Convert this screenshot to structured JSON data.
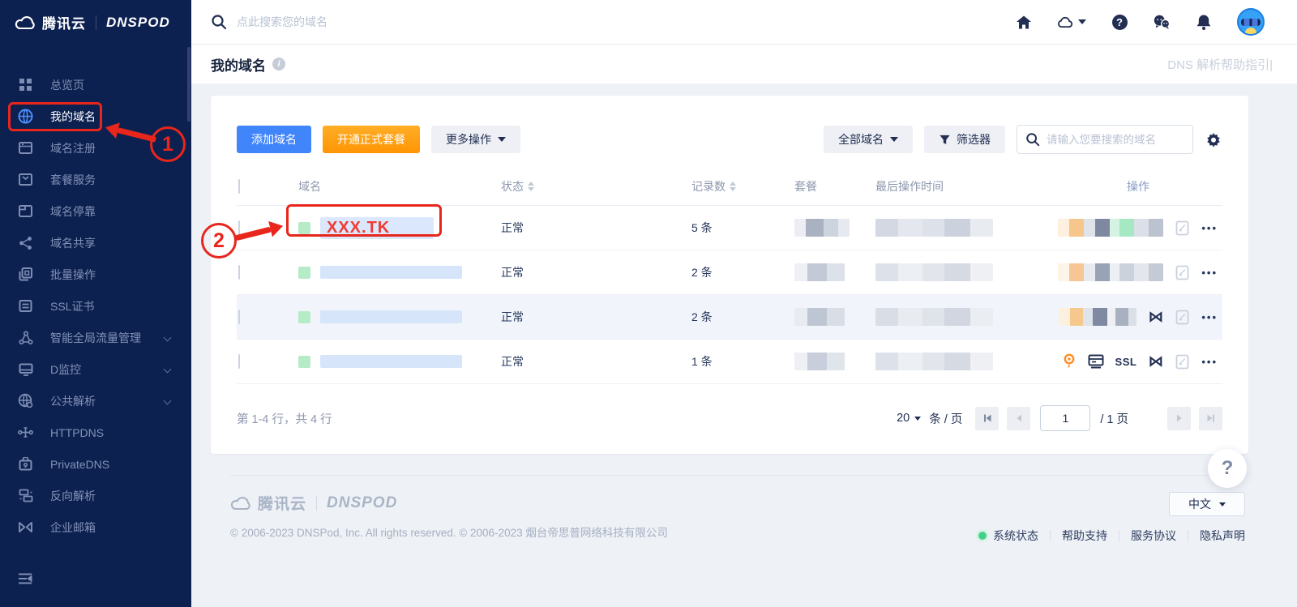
{
  "brand": {
    "name": "腾讯云",
    "product": "DNSPOD"
  },
  "topbar": {
    "search_placeholder": "点此搜索您的域名",
    "help_glyph": "?"
  },
  "sidebar": {
    "items": [
      {
        "label": "总览页",
        "icon": "grid-icon"
      },
      {
        "label": "我的域名",
        "icon": "globe-icon",
        "active": true
      },
      {
        "label": "域名注册",
        "icon": "browser-icon"
      },
      {
        "label": "套餐服务",
        "icon": "package-icon"
      },
      {
        "label": "域名停靠",
        "icon": "parking-icon"
      },
      {
        "label": "域名共享",
        "icon": "share-icon"
      },
      {
        "label": "批量操作",
        "icon": "batch-icon"
      },
      {
        "label": "SSL证书",
        "icon": "certificate-icon"
      },
      {
        "label": "智能全局流量管理",
        "icon": "traffic-icon",
        "expandable": true
      },
      {
        "label": "D监控",
        "icon": "monitor-icon",
        "expandable": true
      },
      {
        "label": "公共解析",
        "icon": "public-dns-icon",
        "expandable": true
      },
      {
        "label": "HTTPDNS",
        "icon": "httpdns-icon"
      },
      {
        "label": "PrivateDNS",
        "icon": "privatedns-icon"
      },
      {
        "label": "反向解析",
        "icon": "reverse-dns-icon"
      },
      {
        "label": "企业邮箱",
        "icon": "mail-icon"
      }
    ]
  },
  "page": {
    "title": "我的域名",
    "help_link": "DNS 解析帮助指引|"
  },
  "toolbar": {
    "add_domain": "添加域名",
    "open_plan": "开通正式套餐",
    "more_actions": "更多操作",
    "all_domains": "全部域名",
    "filter": "筛选器",
    "search_placeholder": "请输入您要搜索的域名"
  },
  "table": {
    "headers": {
      "domain": "域名",
      "status": "状态",
      "records": "记录数",
      "plan": "套餐",
      "last_op": "最后操作时间",
      "actions": "操作"
    },
    "rows": [
      {
        "domain": "XXX.TK",
        "status": "正常",
        "records": "5 条"
      },
      {
        "status": "正常",
        "records": "2 条"
      },
      {
        "status": "正常",
        "records": "2 条"
      },
      {
        "status": "正常",
        "records": "1 条",
        "ssl_label": "SSL"
      }
    ]
  },
  "pagination": {
    "summary": "第 1-4 行，共 4 行",
    "page_size": "20",
    "unit": "条 / 页",
    "current": "1",
    "total": "/ 1 页"
  },
  "floating": {
    "help_glyph": "?"
  },
  "footer": {
    "copyright": "© 2006-2023 DNSPod, Inc. All rights reserved. © 2006-2023 烟台帝思普网络科技有限公司",
    "language": "中文",
    "links": [
      "系统状态",
      "帮助支持",
      "服务协议",
      "隐私声明"
    ]
  },
  "annotations": {
    "step1": "1",
    "step2": "2"
  },
  "colors": {
    "accent_blue": "#4185fb",
    "accent_orange": "#ff9d0a",
    "annotation_red": "#e8261c",
    "status_green": "#42d08c",
    "sidebar_bg": "#0d2150",
    "domain_red": "#f03b33"
  }
}
